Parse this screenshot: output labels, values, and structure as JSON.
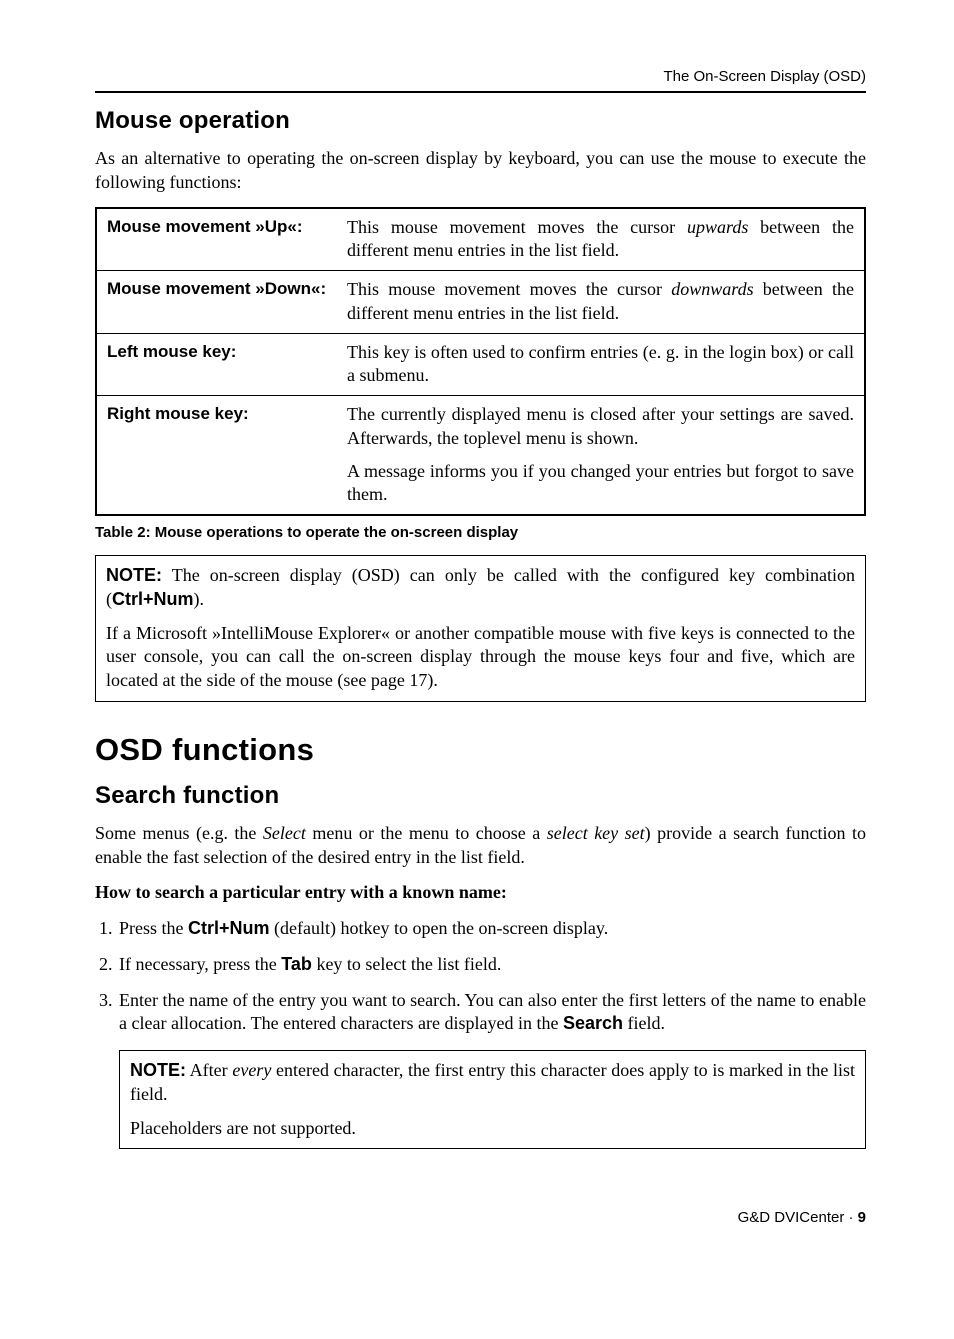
{
  "running_head": "The On-Screen Display (OSD)",
  "h2_mouse": "Mouse operation",
  "p_intro": "As an alternative to operating the on-screen display by keyboard, you can use the mouse to execute the following functions:",
  "table": {
    "rows": [
      {
        "label": "Mouse movement »Up«:",
        "text_a": "This mouse movement moves the cursor ",
        "em": "upwards",
        "text_b": " between the different menu entries in the list field."
      },
      {
        "label": "Mouse movement »Down«:",
        "text_a": "This mouse movement moves the cursor ",
        "em": "downwards",
        "text_b": " between the different menu entries in the list field."
      },
      {
        "label": "Left mouse key:",
        "text_a": "This key is often used to confirm entries (e. g. in the login box) or call a submenu.",
        "em": "",
        "text_b": ""
      },
      {
        "label": "Right mouse key:",
        "text_a": "The currently displayed menu is closed after your settings are saved. Afterwards, the toplevel menu is shown.",
        "em": "",
        "text_b": "",
        "extra": "A message informs you if you changed your entries but forgot to save them."
      }
    ]
  },
  "table_caption": "Table 2: Mouse operations to operate the on-screen display",
  "note1": {
    "label": "NOTE:",
    "p1a": " The on-screen display (OSD) can only be called with the configured key combination (",
    "key1": "Ctrl+Num",
    "p1b": ").",
    "p2": "If a Microsoft »IntelliMouse Explorer« or another compatible mouse with five keys is connected to the user console, you can call the on-screen display through the mouse keys four and five, which are located at the side of the mouse (see page 17)."
  },
  "h1_osd": "OSD functions",
  "h2_search": "Search function",
  "p_search_a": "Some menus (e.g. the ",
  "p_search_em1": "Select",
  "p_search_b": " menu or the menu to choose a ",
  "p_search_em2": "select key set",
  "p_search_c": ") provide a search function to enable the fast selection of the desired entry in the list field.",
  "howto": "How to search a particular entry with a known name:",
  "steps": {
    "s1a": "Press the ",
    "s1key": "Ctrl+Num",
    "s1b": " (default) hotkey to open the on-screen display.",
    "s2a": "If necessary, press the ",
    "s2key": "Tab",
    "s2b": " key to select the list field.",
    "s3a": "Enter the name of the entry you want to search. You can also enter the first letters of the name to enable a clear allocation. The entered characters are displayed in the ",
    "s3field": "Search",
    "s3b": " field."
  },
  "note2": {
    "label": "NOTE:",
    "p1a": " After ",
    "em": "every",
    "p1b": " entered character, the first entry this character does apply to is marked in the list field.",
    "p2": "Placeholders are not supported."
  },
  "footer": {
    "prod": "G&D DVICenter · ",
    "page": "9"
  }
}
